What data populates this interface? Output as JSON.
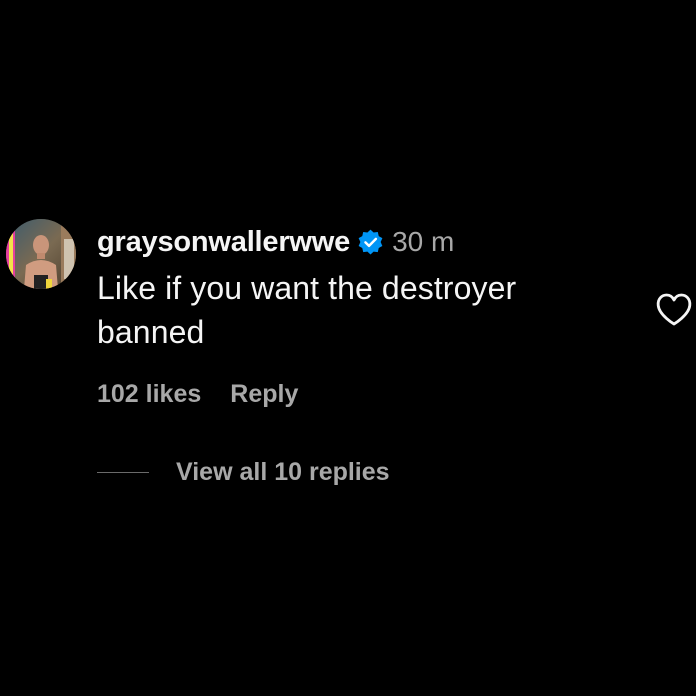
{
  "comment": {
    "username": "graysonwallerwwe",
    "verified_icon": "verified-badge-icon",
    "timestamp": "30 m",
    "text": "Like if you want the destroyer banned",
    "likes_label": "102 likes",
    "reply_label": "Reply",
    "view_replies_label": "View all 10 replies",
    "like_icon": "heart-outline-icon"
  },
  "colors": {
    "background": "#000000",
    "primary_text": "#f5f5f5",
    "secondary_text": "#a8a8a8",
    "verified_blue": "#0095f6"
  }
}
